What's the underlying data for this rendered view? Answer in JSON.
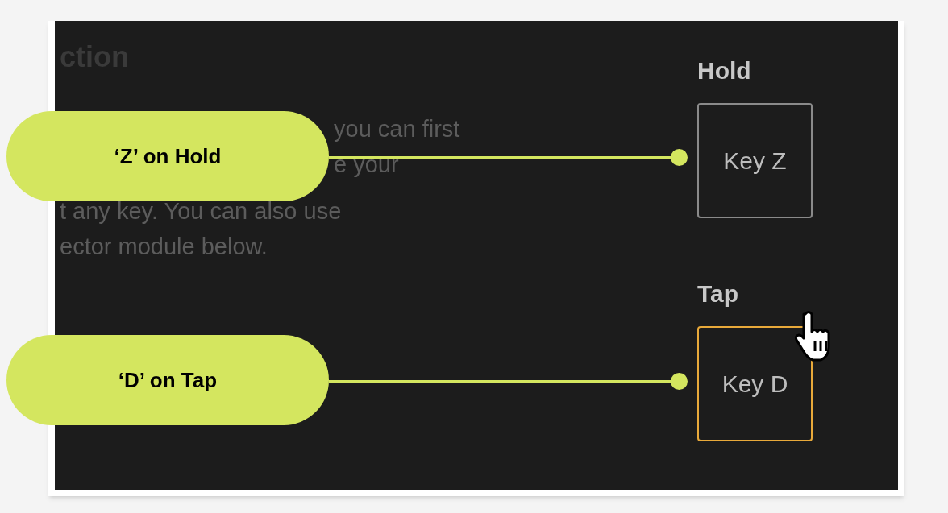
{
  "section": {
    "heading": "ction",
    "lines_right": [
      "you can first",
      "e your"
    ],
    "lines_left": [
      "t any key. You can also use",
      "ector module below."
    ]
  },
  "bindings": [
    {
      "label": "Hold",
      "key": "Key Z",
      "selected": false,
      "callout": "‘Z’ on Hold"
    },
    {
      "label": "Tap",
      "key": "Key D",
      "selected": true,
      "callout": "‘D’ on Tap"
    }
  ]
}
